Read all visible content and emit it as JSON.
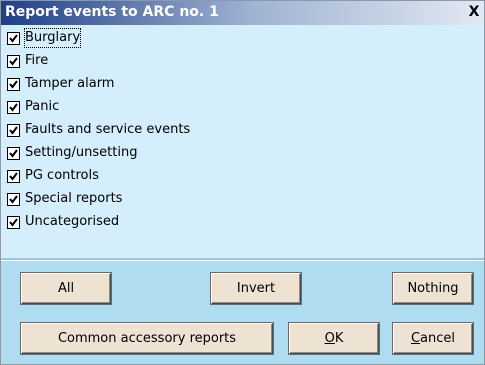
{
  "dialog": {
    "title": "Report events to ARC no. 1",
    "close_label": "X"
  },
  "options": [
    {
      "label": "Burglary",
      "checked": true
    },
    {
      "label": "Fire",
      "checked": true
    },
    {
      "label": "Tamper alarm",
      "checked": true
    },
    {
      "label": "Panic",
      "checked": true
    },
    {
      "label": "Faults and service events",
      "checked": true
    },
    {
      "label": "Setting/unsetting",
      "checked": true
    },
    {
      "label": "PG controls",
      "checked": true
    },
    {
      "label": "Special reports",
      "checked": true
    },
    {
      "label": "Uncategorised",
      "checked": true
    }
  ],
  "buttons": {
    "all": "All",
    "invert": "Invert",
    "nothing": "Nothing",
    "common": "Common accessory reports",
    "ok_mnemonic": "O",
    "ok_rest": "K",
    "cancel_mnemonic": "C",
    "cancel_rest": "ancel"
  },
  "colors": {
    "window_bg": "#d4eefc",
    "button_panel_bg": "#b0dcf2",
    "button_face": "#eee2d3",
    "title_bar_start": "#1f3f86"
  }
}
